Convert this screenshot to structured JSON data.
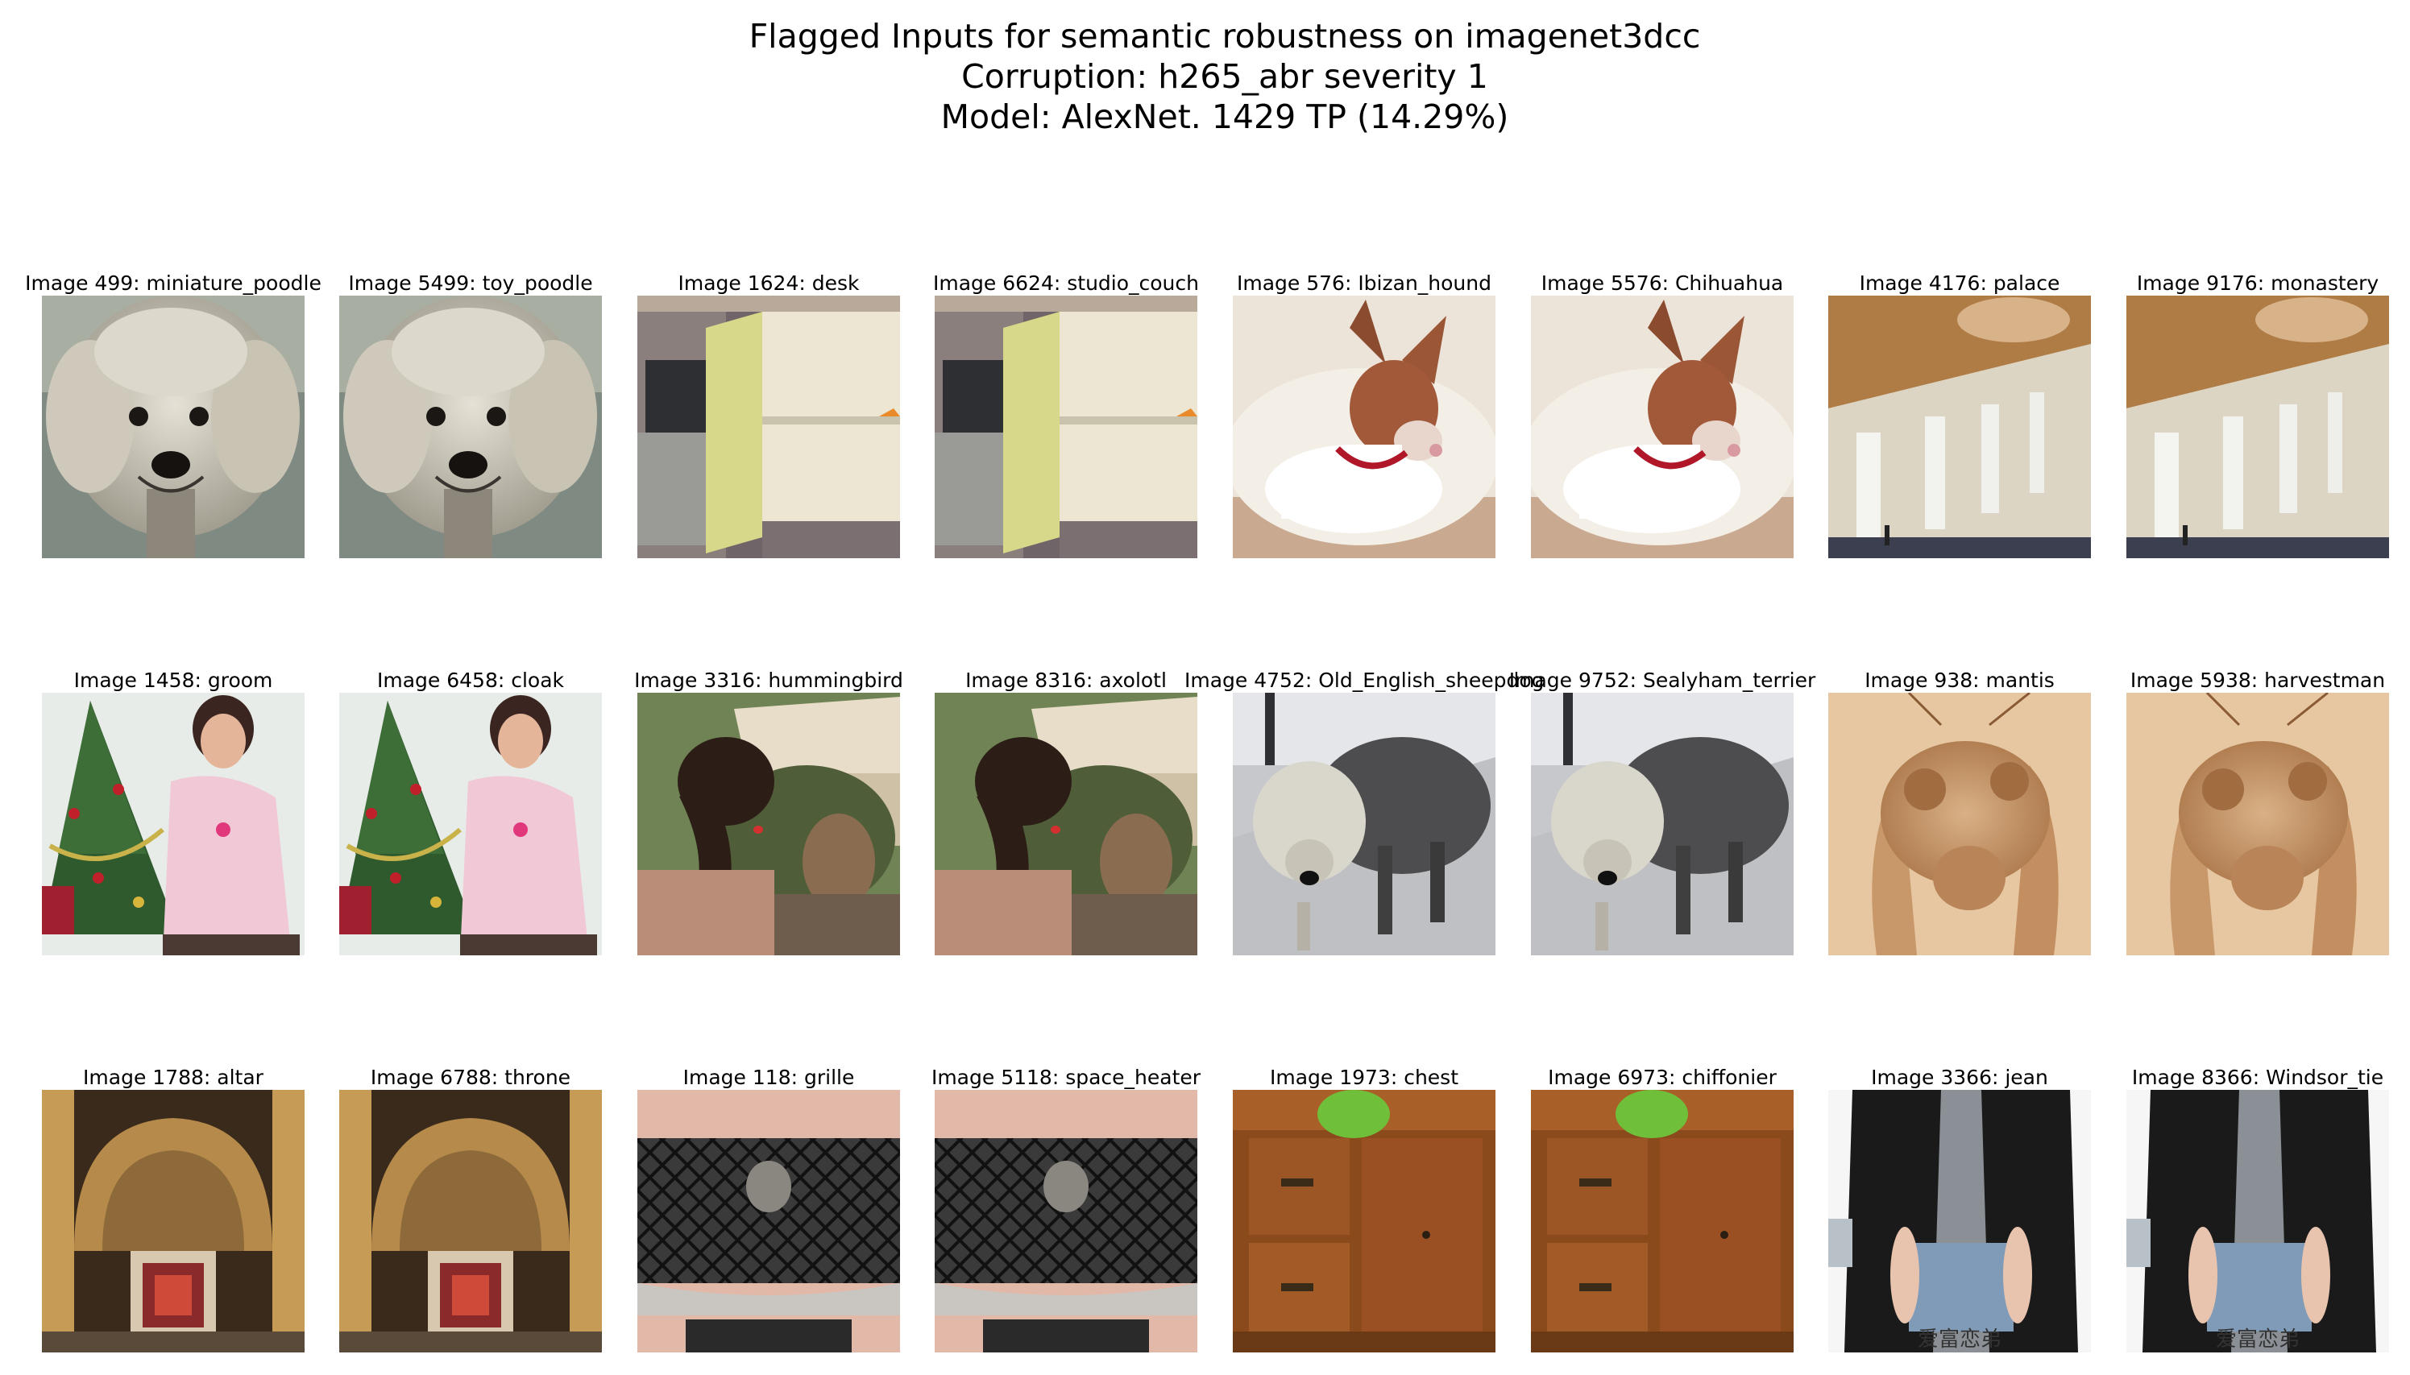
{
  "figure": {
    "title_lines": [
      "Flagged Inputs for semantic robustness on imagenet3dcc",
      "Corruption: h265_abr severity 1",
      "Model: AlexNet. 1429 TP (14.29%)"
    ]
  },
  "grid": [
    [
      {
        "caption": "Image 499: miniature_poodle",
        "scene": "poodle"
      },
      {
        "caption": "Image 5499: toy_poodle",
        "scene": "poodle"
      },
      {
        "caption": "Image 1624: desk",
        "scene": "cabinet"
      },
      {
        "caption": "Image 6624: studio_couch",
        "scene": "cabinet"
      },
      {
        "caption": "Image 576: Ibizan_hound",
        "scene": "hound"
      },
      {
        "caption": "Image 5576: Chihuahua",
        "scene": "hound"
      },
      {
        "caption": "Image 4176: palace",
        "scene": "palace"
      },
      {
        "caption": "Image 9176: monastery",
        "scene": "palace"
      }
    ],
    [
      {
        "caption": "Image 1458: groom",
        "scene": "xmas"
      },
      {
        "caption": "Image 6458: cloak",
        "scene": "xmas"
      },
      {
        "caption": "Image 3316: hummingbird",
        "scene": "woman_back"
      },
      {
        "caption": "Image 8316: axolotl",
        "scene": "woman_back"
      },
      {
        "caption": "Image 4752: Old_English_sheepdog",
        "scene": "sheepdog"
      },
      {
        "caption": "Image 9752: Sealyham_terrier",
        "scene": "sheepdog"
      },
      {
        "caption": "Image 938: mantis",
        "scene": "mantis"
      },
      {
        "caption": "Image 5938: harvestman",
        "scene": "mantis"
      }
    ],
    [
      {
        "caption": "Image 1788: altar",
        "scene": "altar"
      },
      {
        "caption": "Image 6788: throne",
        "scene": "altar"
      },
      {
        "caption": "Image 118: grille",
        "scene": "grille"
      },
      {
        "caption": "Image 5118: space_heater",
        "scene": "grille"
      },
      {
        "caption": "Image 1973: chest",
        "scene": "chest"
      },
      {
        "caption": "Image 6973: chiffonier",
        "scene": "chest"
      },
      {
        "caption": "Image 3366: jean",
        "scene": "jean"
      },
      {
        "caption": "Image 8366: Windsor_tie",
        "scene": "jean"
      }
    ]
  ],
  "watermark_text": "爱富恋弟"
}
